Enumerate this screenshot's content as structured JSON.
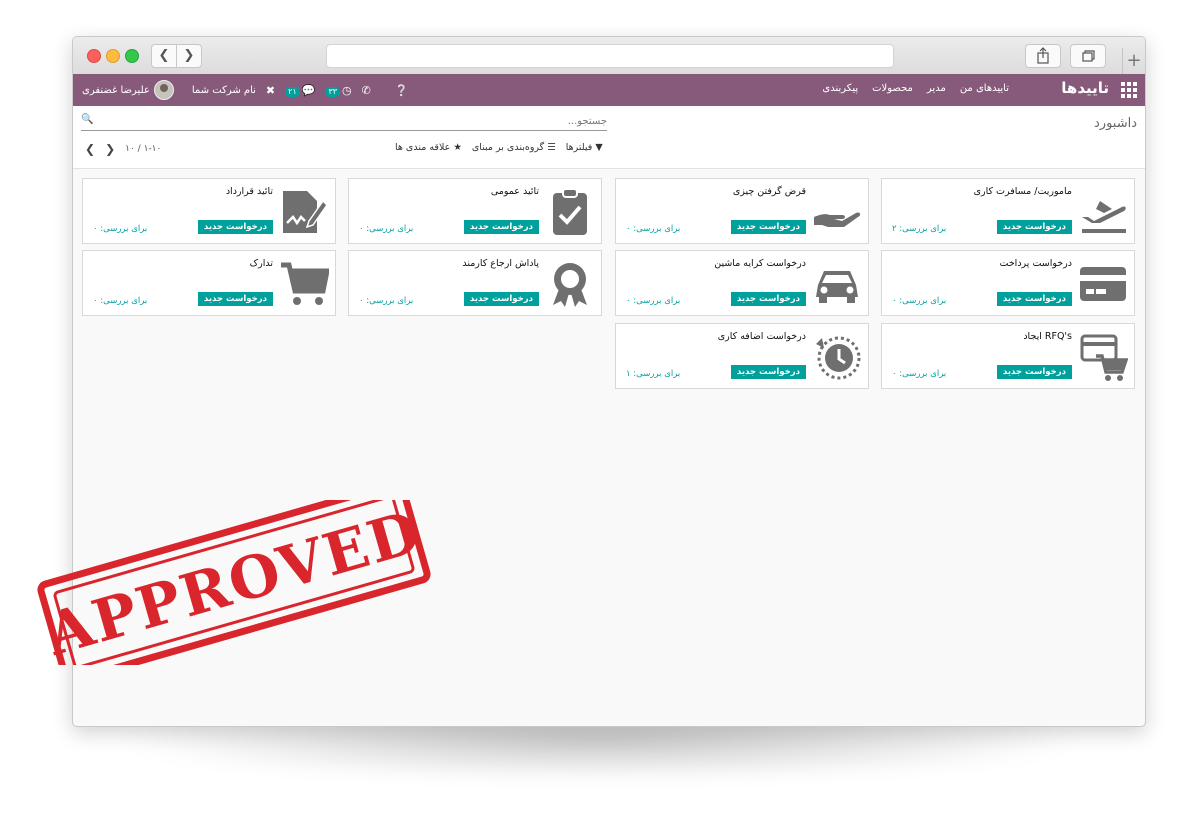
{
  "window": {
    "url": ""
  },
  "navbar": {
    "brand": "تاییدها",
    "menu": [
      "تاییدهای من",
      "مدیر",
      "محصولات",
      "پیکربندی"
    ],
    "user": "علیرضا غضنفری",
    "company": "نام شرکت شما",
    "messages_badge": "۲۱",
    "activities_badge": "۳۳",
    "accent_color": "#875a7b"
  },
  "control_panel": {
    "breadcrumb": "داشبورد",
    "search_placeholder": "جستجو...",
    "filters_label": "فیلترها",
    "groupby_label": "گروه‌بندی بر مبنای",
    "favorites_label": "علاقه مندی ها",
    "pager_value": "۱-۱۰",
    "pager_total": "۱۰"
  },
  "cards": [
    {
      "title": "ماموریت/ مسافرت کاری",
      "button": "درخواست جدید",
      "review": "برای بررسی: ۲",
      "icon": "plane-icon"
    },
    {
      "title": "قرض گرفتن چیزی",
      "button": "درخواست جدید",
      "review": "برای بررسی: ۰",
      "icon": "hand-icon"
    },
    {
      "title": "تائید عمومی",
      "button": "درخواست جدید",
      "review": "برای بررسی: ۰",
      "icon": "clipboard-check-icon"
    },
    {
      "title": "تائید قرارداد",
      "button": "درخواست جدید",
      "review": "برای بررسی: ۰",
      "icon": "contract-sign-icon"
    },
    {
      "title": "درخواست پرداخت",
      "button": "درخواست جدید",
      "review": "برای بررسی: ۰",
      "icon": "credit-card-icon"
    },
    {
      "title": "درخواست کرایه ماشین",
      "button": "درخواست جدید",
      "review": "برای بررسی: ۰",
      "icon": "car-icon"
    },
    {
      "title": "پاداش ارجاع کارمند",
      "button": "درخواست جدید",
      "review": "برای بررسی: ۰",
      "icon": "award-icon"
    },
    {
      "title": "تدارک",
      "button": "درخواست جدید",
      "review": "برای بررسی: ۰",
      "icon": "cart-icon"
    },
    {
      "title": "RFQ's ایجاد",
      "button": "درخواست جدید",
      "review": "برای بررسی: ۰",
      "icon": "card-cart-icon"
    },
    {
      "title": "درخواست اضافه کاری",
      "button": "درخواست جدید",
      "review": "برای بررسی: ۱",
      "icon": "clock-history-icon"
    }
  ],
  "stamp": {
    "text": "APPROVED",
    "color": "#d9262c"
  }
}
